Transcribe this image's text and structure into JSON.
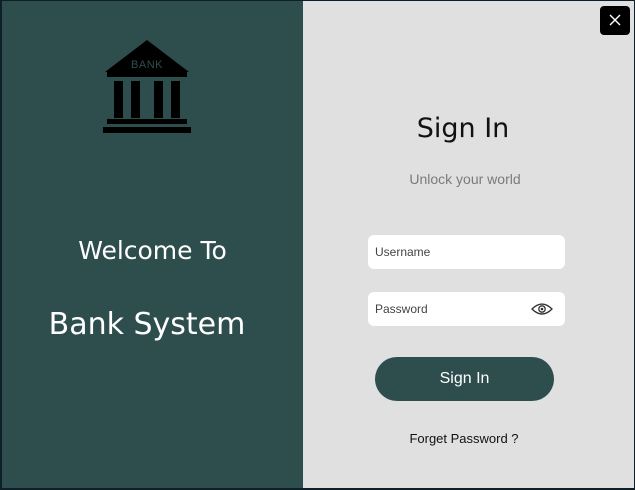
{
  "left_panel": {
    "logo_text": "BANK",
    "welcome_line1": "Welcome To",
    "welcome_line2": "Bank System"
  },
  "right_panel": {
    "title": "Sign In",
    "subtitle": "Unlock your world",
    "username_placeholder": "Username",
    "username_value": "",
    "password_placeholder": "Password",
    "password_value": "",
    "signin_button_label": "Sign In",
    "forget_password_label": "Forget Password ?"
  },
  "icons": {
    "close": "close-icon",
    "eye": "eye-icon",
    "bank": "bank-building-icon"
  },
  "colors": {
    "primary": "#2e4e4e",
    "panel_light": "#e0e0e0",
    "close_bg": "#000000"
  }
}
